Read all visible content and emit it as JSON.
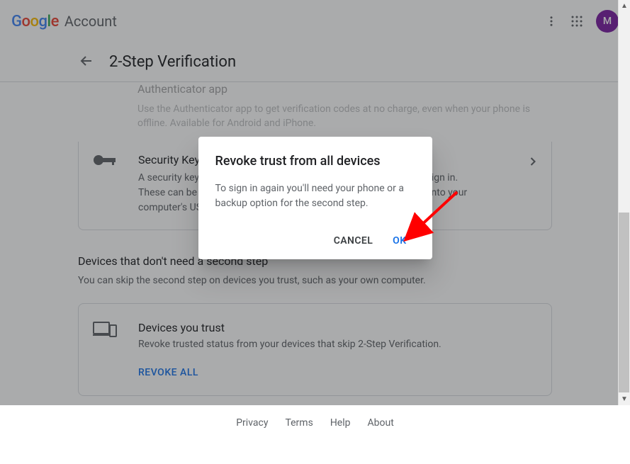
{
  "header": {
    "logo_word": "Google",
    "account_word": "Account",
    "avatar_letter": "M"
  },
  "subheader": {
    "title": "2-Step Verification"
  },
  "auth_app": {
    "title": "Authenticator app",
    "desc": "Use the Authenticator app to get verification codes at no charge, even when your phone is offline. Available for Android and iPhone."
  },
  "security_key": {
    "title": "Security Key",
    "desc": "A security key is a verification method that allows you to securely sign in. These can be built in to your phone, use Bluetooth, or plug directly into your computer's USB port."
  },
  "devices_section": {
    "heading": "Devices that don't need a second step",
    "sub": "You can skip the second step on devices you trust, such as your own computer."
  },
  "devices_card": {
    "title": "Devices you trust",
    "desc": "Revoke trusted status from your devices that skip 2-Step Verification.",
    "action": "REVOKE ALL"
  },
  "footer": {
    "privacy": "Privacy",
    "terms": "Terms",
    "help": "Help",
    "about": "About"
  },
  "dialog": {
    "title": "Revoke trust from all devices",
    "body": "To sign in again you'll need your phone or a backup option for the second step.",
    "cancel": "CANCEL",
    "ok": "OK"
  }
}
